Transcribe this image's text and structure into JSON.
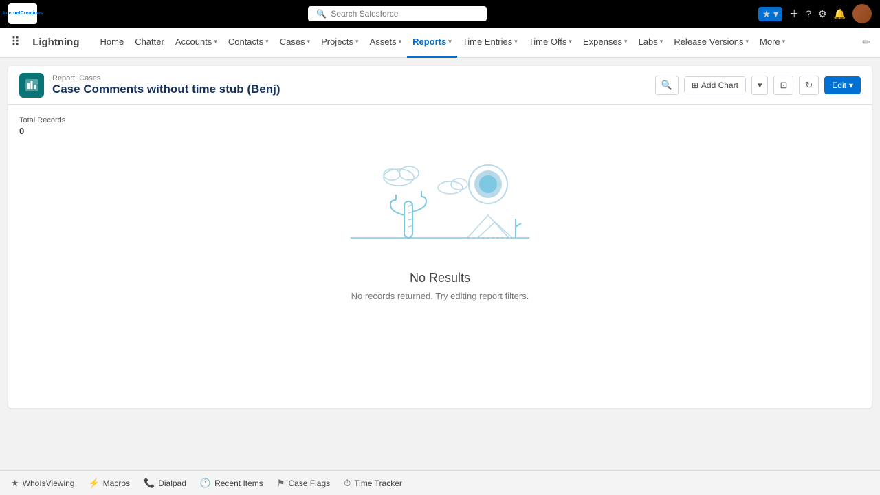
{
  "topbar": {
    "logo_line1": "Internet",
    "logo_line2": "Creations",
    "search_placeholder": "Search Salesforce",
    "star_label": "★ ▾"
  },
  "navbar": {
    "brand": "Lightning",
    "items": [
      {
        "label": "Home",
        "has_chevron": false,
        "active": false
      },
      {
        "label": "Chatter",
        "has_chevron": false,
        "active": false
      },
      {
        "label": "Accounts",
        "has_chevron": true,
        "active": false
      },
      {
        "label": "Contacts",
        "has_chevron": true,
        "active": false
      },
      {
        "label": "Cases",
        "has_chevron": true,
        "active": false
      },
      {
        "label": "Projects",
        "has_chevron": true,
        "active": false
      },
      {
        "label": "Assets",
        "has_chevron": true,
        "active": false
      },
      {
        "label": "Reports",
        "has_chevron": true,
        "active": true
      },
      {
        "label": "Time Entries",
        "has_chevron": true,
        "active": false
      },
      {
        "label": "Time Offs",
        "has_chevron": true,
        "active": false
      },
      {
        "label": "Expenses",
        "has_chevron": true,
        "active": false
      },
      {
        "label": "Labs",
        "has_chevron": true,
        "active": false
      },
      {
        "label": "Release Versions",
        "has_chevron": true,
        "active": false
      },
      {
        "label": "More",
        "has_chevron": true,
        "active": false
      }
    ]
  },
  "report": {
    "subtitle": "Report: Cases",
    "title": "Case Comments without time stub (Benj)",
    "total_records_label": "Total Records",
    "total_records_value": "0",
    "no_results_title": "No Results",
    "no_results_sub": "No records returned. Try editing report filters.",
    "actions": {
      "add_chart": "Add Chart",
      "edit": "Edit",
      "search_icon": "🔍",
      "filter_icon": "▾",
      "save_icon": "⊡",
      "refresh_icon": "↻",
      "edit_dropdown_icon": "▾"
    }
  },
  "bottom_bar": {
    "items": [
      {
        "icon": "★",
        "label": "WhoIsViewing"
      },
      {
        "icon": "⚡",
        "label": "Macros"
      },
      {
        "icon": "📞",
        "label": "Dialpad"
      },
      {
        "icon": "🕐",
        "label": "Recent Items"
      },
      {
        "icon": "⚑",
        "label": "Case Flags"
      },
      {
        "icon": "⏱",
        "label": "Time Tracker"
      }
    ]
  }
}
